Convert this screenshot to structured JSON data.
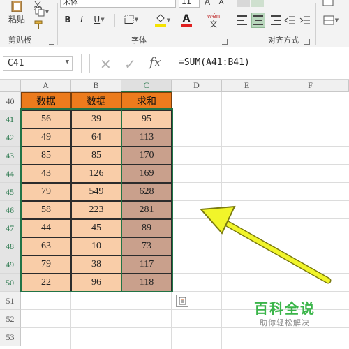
{
  "ribbon": {
    "paste_label": "粘贴",
    "clipboard_label": "剪贴板",
    "font_name": "宋体",
    "font_size": "11",
    "bold": "B",
    "italic": "I",
    "underline": "U",
    "font_group_label": "字体",
    "font_color_glyph": "A",
    "phonetic_glyph": "wén",
    "grow_font_glyph": "A",
    "align_group_label": "对齐方式"
  },
  "formula_bar": {
    "name_box": "C41",
    "formula": "=SUM(A41:B41)",
    "fx_label": "fx"
  },
  "columns": [
    "A",
    "B",
    "C",
    "D",
    "E",
    "F"
  ],
  "rows": [
    "40",
    "41",
    "42",
    "43",
    "44",
    "45",
    "46",
    "47",
    "48",
    "49",
    "50",
    "51",
    "52",
    "53"
  ],
  "table": {
    "headers": [
      "数据",
      "数据",
      "求和"
    ],
    "rows": [
      [
        "56",
        "39",
        "95"
      ],
      [
        "49",
        "64",
        "113"
      ],
      [
        "85",
        "85",
        "170"
      ],
      [
        "43",
        "126",
        "169"
      ],
      [
        "79",
        "549",
        "628"
      ],
      [
        "58",
        "223",
        "281"
      ],
      [
        "44",
        "45",
        "89"
      ],
      [
        "63",
        "10",
        "73"
      ],
      [
        "79",
        "38",
        "117"
      ],
      [
        "22",
        "96",
        "118"
      ]
    ]
  },
  "colors": {
    "header_fill": "#ec7b1d",
    "data_fill": "#f9cda8",
    "sum_fill": "#c9a08c",
    "selection": "#217346",
    "arrow": "#f1f52a"
  },
  "watermark": {
    "title": "百科全说",
    "subtitle": "助你轻松解决"
  }
}
